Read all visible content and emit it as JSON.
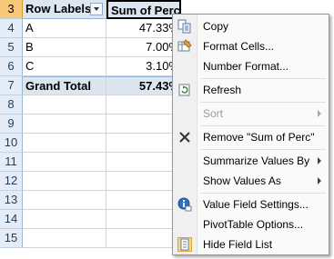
{
  "sheet": {
    "row_numbers": [
      "3",
      "4",
      "5",
      "6",
      "7",
      "8",
      "9",
      "10",
      "11",
      "12",
      "13",
      "14",
      "15"
    ],
    "header": {
      "col_a": "Row Labels",
      "col_b": "Sum of Perc"
    },
    "rows": [
      {
        "label": "A",
        "value": "47.33%"
      },
      {
        "label": "B",
        "value": "7.00%"
      },
      {
        "label": "C",
        "value": "3.10%"
      }
    ],
    "total": {
      "label": "Grand Total",
      "value": "57.43%"
    }
  },
  "context_menu": {
    "items": [
      {
        "label": "Copy",
        "icon": "copy-icon"
      },
      {
        "label": "Format Cells...",
        "icon": "format-cells-icon"
      },
      {
        "label": "Number Format..."
      },
      {
        "label": "Refresh",
        "icon": "refresh-icon"
      },
      {
        "label": "Sort",
        "disabled": true
      },
      {
        "label": "Remove \"Sum of Perc\"",
        "icon": "close-icon"
      },
      {
        "label": "Summarize Values By"
      },
      {
        "label": "Show Values As"
      },
      {
        "label": "Value Field Settings...",
        "icon": "field-settings-icon"
      },
      {
        "label": "PivotTable Options..."
      },
      {
        "label": "Hide Field List",
        "icon": "field-list-icon"
      }
    ]
  },
  "colors": {
    "header_fill": "#dce6f1",
    "row_header_fill": "#e4ecf7",
    "selected_row_header": "#f5c979"
  }
}
